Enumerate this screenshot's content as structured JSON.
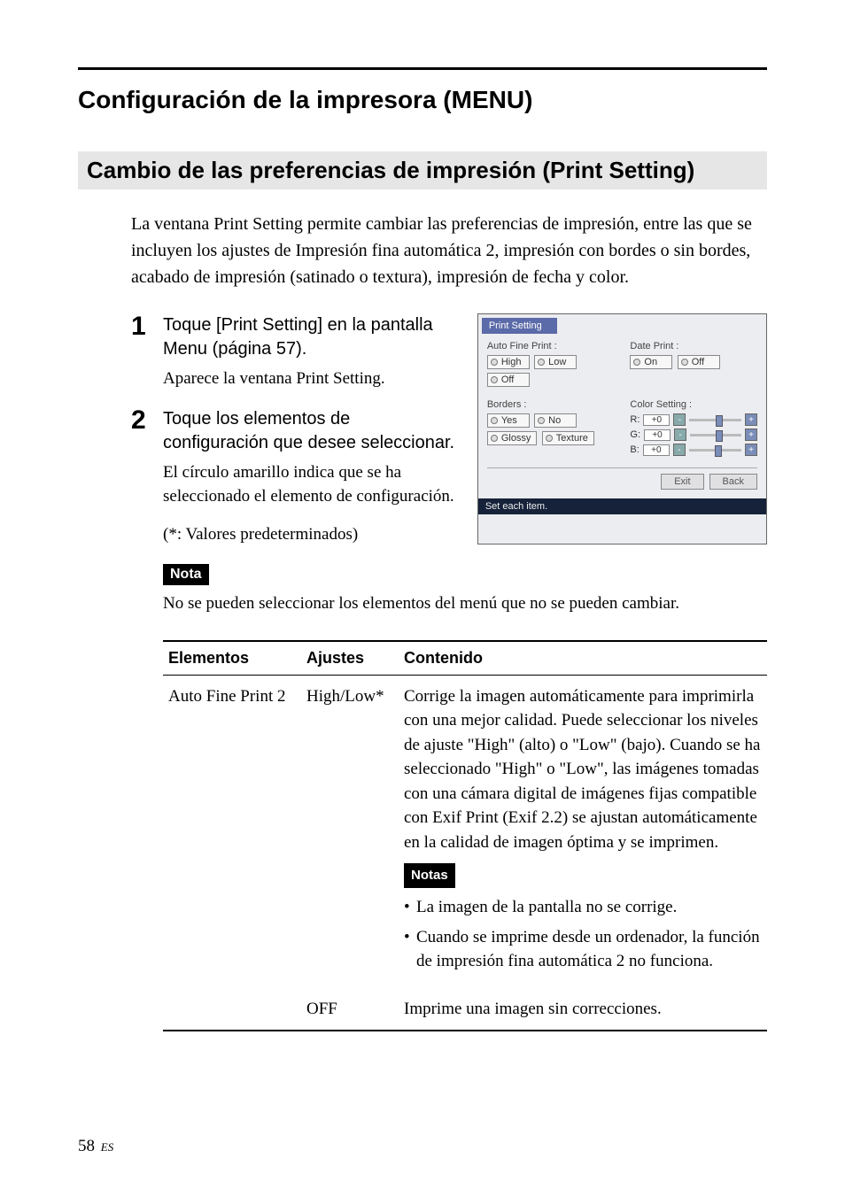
{
  "headings": {
    "h1": "Configuración de la impresora (MENU)",
    "h2": "Cambio de las preferencias de impresión (Print Setting)"
  },
  "intro": "La ventana Print Setting permite cambiar las preferencias de impresión, entre las que se incluyen los ajustes de Impresión fina automática 2, impresión con bordes o sin bordes, acabado de impresión (satinado o textura), impresión de fecha y color.",
  "steps": [
    {
      "num": "1",
      "title": "Toque [Print Setting] en la pantalla Menu (página 57).",
      "sub": "Aparece la ventana Print Setting."
    },
    {
      "num": "2",
      "title": "Toque los elementos de configuración que desee seleccionar.",
      "sub": "El círculo amarillo indica que se ha seleccionado el elemento de configuración."
    }
  ],
  "defaults_note": "(*: Valores predeterminados)",
  "nota": {
    "label": "Nota",
    "text": "No se pueden seleccionar los elementos del menú que no se pueden cambiar."
  },
  "screenshot": {
    "tab": "Print Setting",
    "groups": {
      "auto_fine": {
        "label": "Auto Fine Print :",
        "options": [
          "High",
          "Low",
          "Off"
        ]
      },
      "date_print": {
        "label": "Date Print :",
        "options": [
          "On",
          "Off"
        ]
      },
      "borders": {
        "label": "Borders :",
        "options": [
          "Yes",
          "No",
          "Glossy",
          "Texture"
        ]
      },
      "color_setting": {
        "label": "Color Setting :",
        "channels": [
          {
            "name": "R:",
            "value": "+0"
          },
          {
            "name": "G:",
            "value": "+0"
          },
          {
            "name": "B:",
            "value": "+0"
          }
        ]
      }
    },
    "buttons": {
      "exit": "Exit",
      "back": "Back"
    },
    "status": "Set each item."
  },
  "table": {
    "headers": {
      "elementos": "Elementos",
      "ajustes": "Ajustes",
      "contenido": "Contenido"
    },
    "rows": [
      {
        "elemento": "Auto Fine Print 2",
        "ajuste": "High/Low*",
        "contenido": "Corrige la imagen automáticamente para imprimirla con una mejor calidad. Puede seleccionar los niveles de ajuste \"High\" (alto) o \"Low\" (bajo). Cuando se ha seleccionado \"High\" o \"Low\", las imágenes tomadas con una cámara digital de imágenes fijas compatible con Exif Print (Exif 2.2) se ajustan automáticamente en la calidad de imagen óptima y se imprimen.",
        "notas_label": "Notas",
        "notas": [
          "La imagen de la pantalla no se corrige.",
          "Cuando se imprime desde un ordenador, la función de impresión fina automática 2 no funciona."
        ]
      },
      {
        "elemento": "",
        "ajuste": "OFF",
        "contenido": "Imprime una imagen sin correcciones."
      }
    ]
  },
  "chart_data": {
    "type": "table",
    "title": "Print Setting options",
    "headers": [
      "Elementos",
      "Ajustes",
      "Contenido"
    ],
    "rows": [
      [
        "Auto Fine Print 2",
        "High/Low*",
        "Corrige la imagen automáticamente para imprimirla con una mejor calidad. Puede seleccionar los niveles de ajuste \"High\" (alto) o \"Low\" (bajo). Cuando se ha seleccionado \"High\" o \"Low\", las imágenes tomadas con una cámara digital de imágenes fijas compatible con Exif Print (Exif 2.2) se ajustan automáticamente en la calidad de imagen óptima y se imprimen."
      ],
      [
        "",
        "OFF",
        "Imprime una imagen sin correcciones."
      ]
    ]
  },
  "page_number": {
    "num": "58",
    "lang": "ES"
  }
}
